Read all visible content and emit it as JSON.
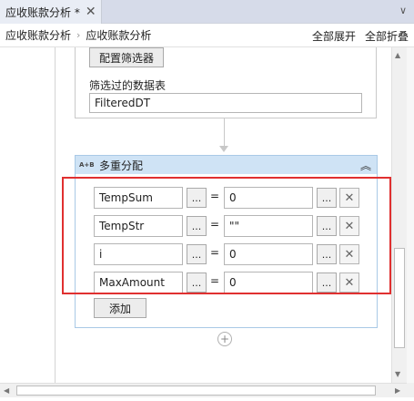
{
  "tab": {
    "label": "应收账款分析 *",
    "close": "✕",
    "dropdown": "∨"
  },
  "breadcrumb": {
    "items": [
      "应收账款分析",
      "应收账款分析"
    ],
    "separator": "›"
  },
  "actions": {
    "expand_all": "全部展开",
    "collapse_all": "全部折叠"
  },
  "filter_activity": {
    "config_button": "配置筛选器",
    "output_label": "筛选过的数据表",
    "output_value": "FilteredDT"
  },
  "assign_activity": {
    "icon_text": "A+B",
    "title": "多重分配",
    "collapse_icon": "︽",
    "ellipsis": "...",
    "equals": "=",
    "delete_icon": "✕",
    "rows": [
      {
        "variable": "TempSum",
        "value": "0"
      },
      {
        "variable": "TempStr",
        "value": "\"\""
      },
      {
        "variable": "i",
        "value": "0"
      },
      {
        "variable": "MaxAmount",
        "value": "0"
      }
    ],
    "add_button": "添加"
  },
  "add_activity_icon": "+",
  "scroll": {
    "up": "▲",
    "down": "▼",
    "left": "◀",
    "right": "▶"
  },
  "colors": {
    "highlight_box": "#e03030",
    "assign_header": "#cfe3f5"
  }
}
